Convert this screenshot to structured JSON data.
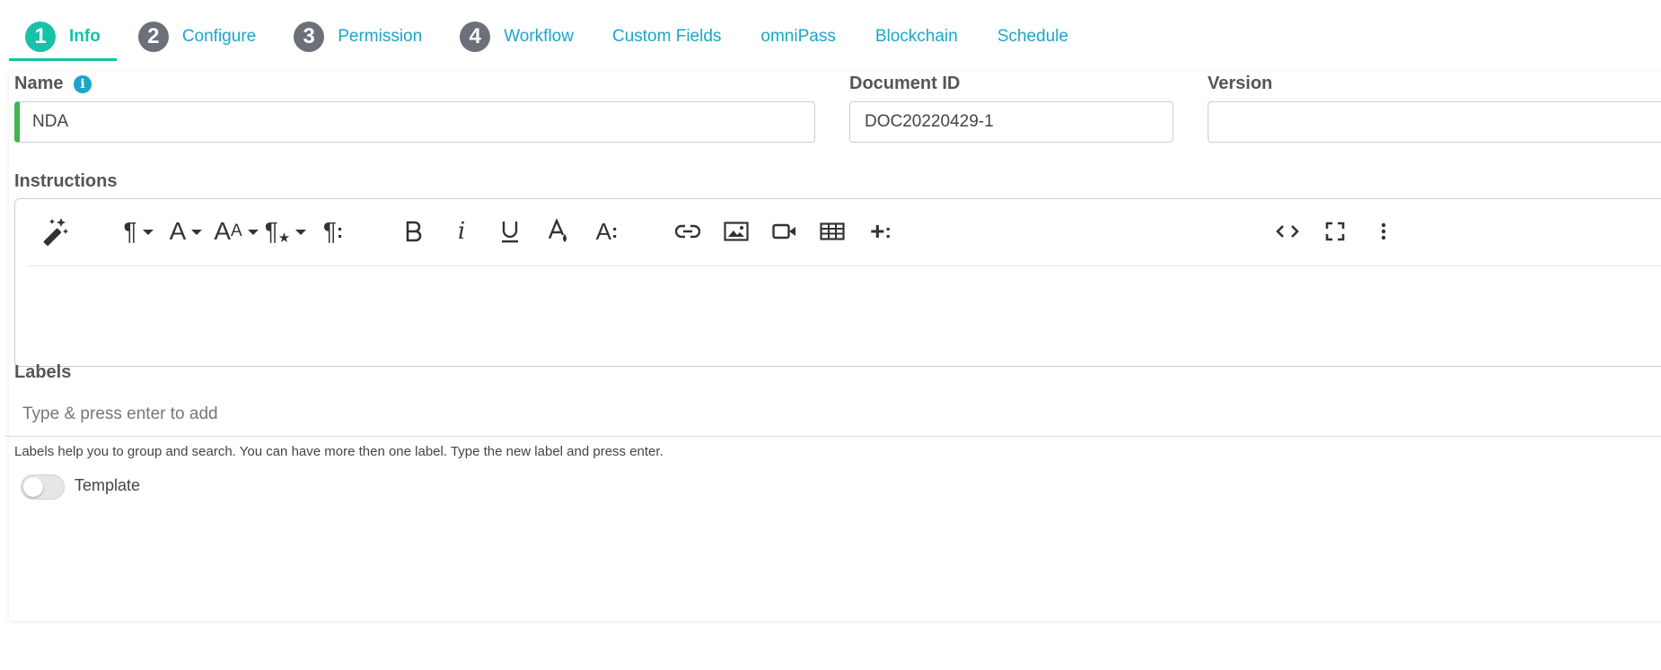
{
  "tabs": [
    {
      "number": "1",
      "label": "Info",
      "active": true
    },
    {
      "number": "2",
      "label": "Configure"
    },
    {
      "number": "3",
      "label": "Permission"
    },
    {
      "number": "4",
      "label": "Workflow"
    },
    {
      "label": "Custom Fields"
    },
    {
      "label": "omniPass"
    },
    {
      "label": "Blockchain"
    },
    {
      "label": "Schedule"
    }
  ],
  "form": {
    "name_label": "Name",
    "name_value": "NDA",
    "docid_label": "Document ID",
    "docid_value": "DOC20220429-1",
    "version_label": "Version",
    "version_value": "",
    "instructions_label": "Instructions",
    "labels_label": "Labels",
    "labels_placeholder": "Type & press enter to add",
    "labels_helper": "Labels help you to group and search. You can have more then one label. Type the new label and press enter.",
    "template_label": "Template",
    "template_on": false
  },
  "toolbar_icons": [
    "magic-wand-icon",
    "paragraph-format-icon",
    "font-family-icon",
    "font-size-icon",
    "paragraph-style-icon",
    "more-paragraph-icon",
    "bold-icon",
    "italic-icon",
    "underline-icon",
    "text-color-icon",
    "more-text-icon",
    "link-icon",
    "image-icon",
    "video-icon",
    "table-icon",
    "insert-more-icon",
    "code-view-icon",
    "fullscreen-icon",
    "more-options-icon"
  ],
  "colors": {
    "accent": "#16c2a8",
    "link": "#1aa6c9",
    "inactive_step": "#6c7079",
    "valid": "#3fb54f"
  }
}
